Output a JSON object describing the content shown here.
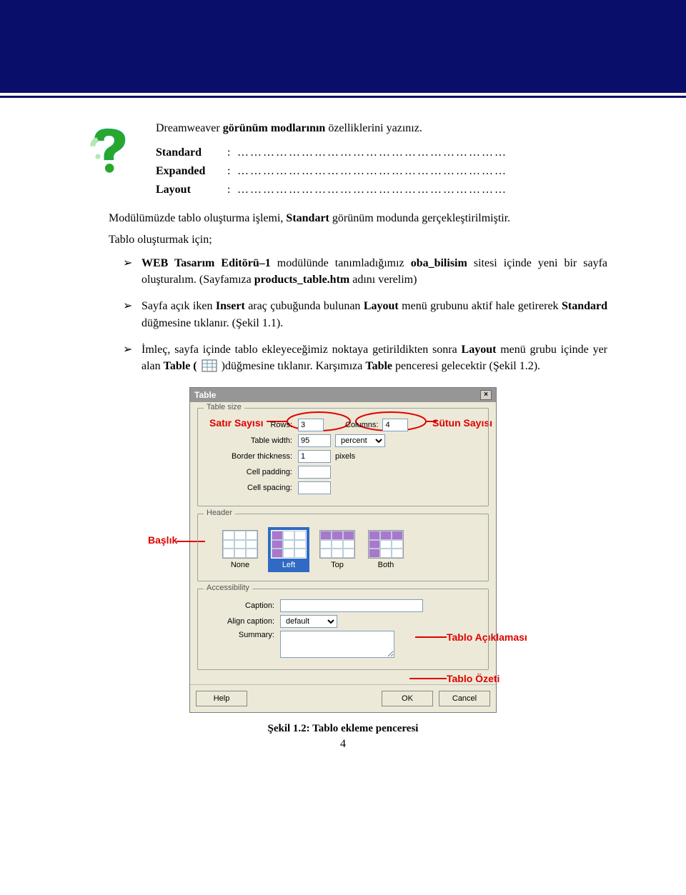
{
  "header": {},
  "intro": {
    "lead_pre": "Dreamweaver ",
    "lead_bold": "görünüm modlarının",
    "lead_post": " özelliklerini yazınız.",
    "modes": [
      {
        "label": "Standard",
        "dots": "………………………………………………………"
      },
      {
        "label": "Expanded",
        "dots": "………………………………………………………"
      },
      {
        "label": "Layout",
        "dots": "………………………………………………………"
      }
    ]
  },
  "p_module_parts": {
    "a": "Modülümüzde tablo oluşturma işlemi, ",
    "b": "Standart",
    "c": " görünüm modunda gerçekleştirilmiştir."
  },
  "p_create": "Tablo oluşturmak için;",
  "bullets": {
    "b1": {
      "a": "WEB Tasarım Editörü–1",
      "b": " modülünde tanımladığımız ",
      "c": "oba_bilisim",
      "d": " sitesi içinde yeni bir sayfa oluşturalım. (Sayfamıza ",
      "e": "products_table.htm",
      "f": " adını verelim)"
    },
    "b2": {
      "a": "Sayfa açık iken ",
      "b": "Insert",
      "c": " araç çubuğunda bulunan ",
      "d": "Layout",
      "e": " menü grubunu aktif hale getirerek ",
      "f": "Standard",
      "g": " düğmesine tıklanır. (Şekil 1.1)."
    },
    "b3": {
      "a": "İmleç, sayfa içinde tablo ekleyeceğimiz noktaya getirildikten sonra ",
      "b": "Layout",
      "c": " menü grubu içinde yer alan ",
      "d": "Table (",
      "e": " )düğmesine tıklanır. Karşımıza ",
      "f": "Table",
      "g": " penceresi gelecektir (Şekil 1.2)."
    }
  },
  "dialog": {
    "title": "Table",
    "group_size": "Table size",
    "rows_label": "Rows:",
    "rows_value": "3",
    "cols_label": "Columns:",
    "cols_value": "4",
    "width_label": "Table width:",
    "width_value": "95",
    "width_unit": "percent",
    "border_label": "Border thickness:",
    "border_value": "1",
    "border_unit": "pixels",
    "cellpad_label": "Cell padding:",
    "cellpad_value": "",
    "cellspc_label": "Cell spacing:",
    "cellspc_value": "",
    "group_header": "Header",
    "hdr_none": "None",
    "hdr_left": "Left",
    "hdr_top": "Top",
    "hdr_both": "Both",
    "group_acc": "Accessibility",
    "caption_label": "Caption:",
    "caption_value": "",
    "align_label": "Align caption:",
    "align_value": "default",
    "summary_label": "Summary:",
    "summary_value": "",
    "btn_help": "Help",
    "btn_ok": "OK",
    "btn_cancel": "Cancel"
  },
  "annotations": {
    "satir": "Satır Sayısı",
    "sutun": "Sütun Sayısı",
    "baslik": "Başlık",
    "tablo_aciklamasi": "Tablo Açıklaması",
    "tablo_ozeti": "Tablo Özeti"
  },
  "caption": "Şekil 1.2: Tablo ekleme penceresi",
  "page_number": "4"
}
